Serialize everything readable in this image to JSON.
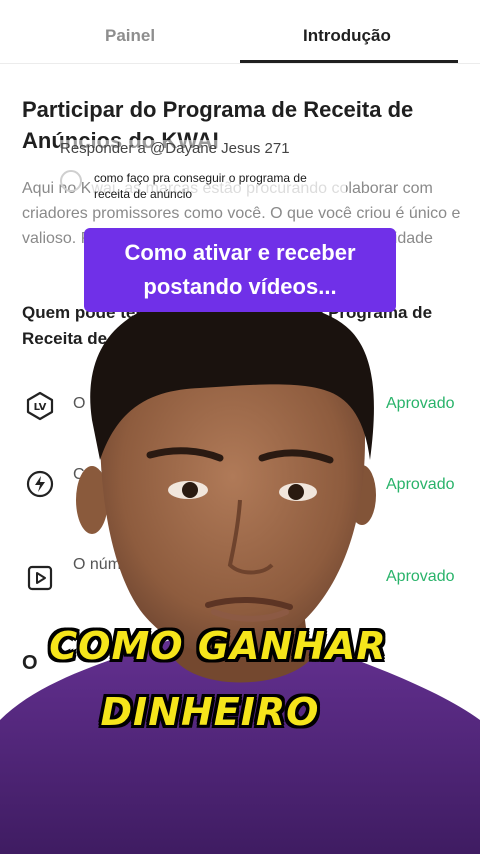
{
  "tabs": [
    {
      "label": "Painel",
      "active": false
    },
    {
      "label": "Introdução",
      "active": true
    }
  ],
  "article": {
    "title": "Participar do Programa de Receita de Anúncios do KWAI",
    "intro": "Aqui no Kwai, as marcas estão procurando colaborar com criadores promissores como você. O que você criou é único e valioso. Programa de receita, aproveite esta oportunidade",
    "section_heading": "Quem pode ter acesso antecipado ao Programa de Receita de Anúncios",
    "requirements": [
      {
        "icon": "level-badge-icon",
        "icon_text": "LV",
        "text": "O número de nível",
        "status": "Aprovado"
      },
      {
        "icon": "lightning-coin-icon",
        "text": "Conteúdo original",
        "status": "Aprovado"
      },
      {
        "icon": "video-play-icon",
        "text": "O número de vídeos postados nos",
        "status": "Aprovado"
      }
    ],
    "cut_text": "O"
  },
  "comment_overlay": {
    "reply_to": "Responder a @Dayane Jesus 271",
    "comment": "como faço pra conseguir o programa de receita de anúncio"
  },
  "caption": {
    "line1": "Como ativar e receber",
    "line2": "postando vídeos..."
  },
  "overlay_text": {
    "line1": "COMO GANHAR",
    "line2": "DINHEIRO"
  },
  "colors": {
    "approved": "#29b36a",
    "caption_bg": "#7030e8",
    "overlay_text": "#f5e51b",
    "shirt": "#5a2a80"
  }
}
